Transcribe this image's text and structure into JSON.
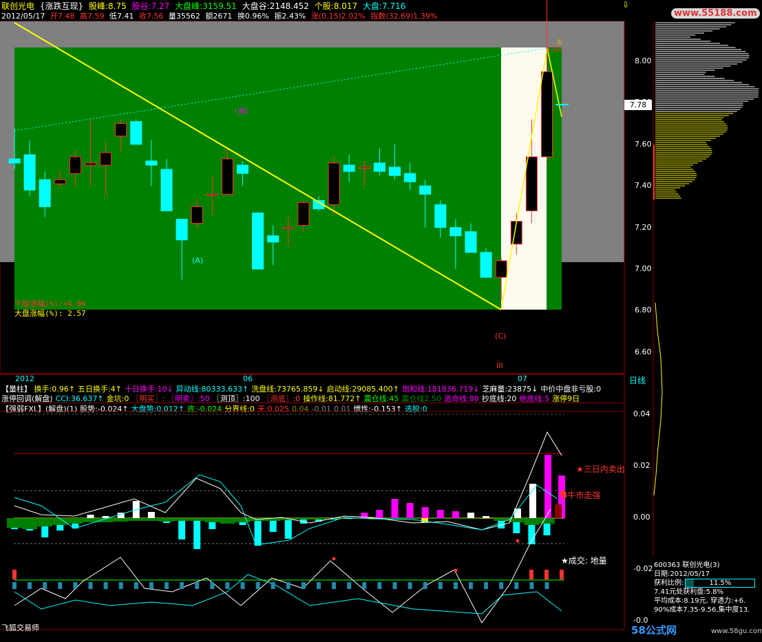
{
  "header": {
    "title": "联创光电",
    "indicator_name": "{涨跌互现}",
    "stock_peak": "股峰:8.75",
    "stock_valley": "股谷:7.27",
    "market_peak": "大盘峰:3159.51",
    "market_valley": "大盘谷:2148.452",
    "individual": "个股:8.017",
    "market": "大盘:7.716",
    "date": "2012/05/17",
    "open": "开7.48",
    "high": "高7.59",
    "low": "低7.41",
    "close": "收7.56",
    "volume": "量35562",
    "amount": "额2671",
    "turnover": "换0.96%",
    "amplitude": "振2.43%",
    "change": "涨(0.15)2.02%",
    "index_change": "指数(32.69)1.39%"
  },
  "main_chart": {
    "labels": {
      "A": "(A)",
      "B": "(B)",
      "C": "(C)",
      "roman3": "III",
      "circle1": "①",
      "peak_value": "8.50",
      "stock_change": "个股涨幅(%):+4.96",
      "market_change": "大盘涨幅(%): 2.57"
    },
    "price_axis": [
      "8.00",
      "7.80",
      "7.60",
      "7.40",
      "7.20",
      "7.00",
      "6.80",
      "6.60"
    ],
    "current_price_tag": "7.78",
    "time_axis": [
      "2012",
      "06",
      "07"
    ],
    "period": "日线"
  },
  "chart_data": {
    "type": "candlestick",
    "candles": [
      {
        "o": 7.53,
        "h": 7.68,
        "l": 7.48,
        "c": 7.51
      },
      {
        "o": 7.55,
        "h": 7.62,
        "l": 7.35,
        "c": 7.38
      },
      {
        "o": 7.43,
        "h": 7.47,
        "l": 7.25,
        "c": 7.3
      },
      {
        "o": 7.41,
        "h": 7.47,
        "l": 7.39,
        "c": 7.43
      },
      {
        "o": 7.46,
        "h": 7.57,
        "l": 7.4,
        "c": 7.54
      },
      {
        "o": 7.5,
        "h": 7.72,
        "l": 7.4,
        "c": 7.51
      },
      {
        "o": 7.5,
        "h": 7.61,
        "l": 7.35,
        "c": 7.56
      },
      {
        "o": 7.64,
        "h": 7.72,
        "l": 7.56,
        "c": 7.7
      },
      {
        "o": 7.71,
        "h": 7.72,
        "l": 7.6,
        "c": 7.6
      },
      {
        "o": 7.52,
        "h": 7.62,
        "l": 7.4,
        "c": 7.5
      },
      {
        "o": 7.48,
        "h": 7.53,
        "l": 7.28,
        "c": 7.28
      },
      {
        "o": 7.24,
        "h": 7.24,
        "l": 6.95,
        "c": 7.14
      },
      {
        "o": 7.22,
        "h": 7.34,
        "l": 7.2,
        "c": 7.3
      },
      {
        "o": 7.36,
        "h": 7.45,
        "l": 7.26,
        "c": 7.36
      },
      {
        "o": 7.36,
        "h": 7.58,
        "l": 7.35,
        "c": 7.53
      },
      {
        "o": 7.5,
        "h": 7.52,
        "l": 7.4,
        "c": 7.46
      },
      {
        "o": 7.27,
        "h": 7.27,
        "l": 7.0,
        "c": 7.0
      },
      {
        "o": 7.16,
        "h": 7.21,
        "l": 7.02,
        "c": 7.13
      },
      {
        "o": 7.2,
        "h": 7.25,
        "l": 7.11,
        "c": 7.2
      },
      {
        "o": 7.21,
        "h": 7.33,
        "l": 7.18,
        "c": 7.32
      },
      {
        "o": 7.33,
        "h": 7.35,
        "l": 7.28,
        "c": 7.29
      },
      {
        "o": 7.31,
        "h": 7.54,
        "l": 7.26,
        "c": 7.51
      },
      {
        "o": 7.5,
        "h": 7.55,
        "l": 7.42,
        "c": 7.47
      },
      {
        "o": 7.49,
        "h": 7.52,
        "l": 7.4,
        "c": 7.49
      },
      {
        "o": 7.51,
        "h": 7.58,
        "l": 7.45,
        "c": 7.47
      },
      {
        "o": 7.49,
        "h": 7.6,
        "l": 7.43,
        "c": 7.45
      },
      {
        "o": 7.46,
        "h": 7.51,
        "l": 7.38,
        "c": 7.42
      },
      {
        "o": 7.4,
        "h": 7.43,
        "l": 7.2,
        "c": 7.36
      },
      {
        "o": 7.31,
        "h": 7.33,
        "l": 7.15,
        "c": 7.2
      },
      {
        "o": 7.2,
        "h": 7.24,
        "l": 7.0,
        "c": 7.16
      },
      {
        "o": 7.18,
        "h": 7.22,
        "l": 7.08,
        "c": 7.08
      },
      {
        "o": 7.08,
        "h": 7.1,
        "l": 6.96,
        "c": 6.96
      },
      {
        "o": 6.96,
        "h": 7.05,
        "l": 6.85,
        "c": 7.04
      },
      {
        "o": 7.12,
        "h": 7.27,
        "l": 7.07,
        "c": 7.23
      },
      {
        "o": 7.28,
        "h": 7.72,
        "l": 7.22,
        "c": 7.54
      },
      {
        "o": 7.54,
        "h": 8.47,
        "l": 7.52,
        "c": 7.95
      }
    ]
  },
  "info_row1": {
    "bracket": "【量柱】",
    "items": [
      {
        "text": "换手:0.96↑",
        "color": "#ffff00"
      },
      {
        "text": "五日换手:4↑",
        "color": "#ffff00"
      },
      {
        "text": "十日换手:10↓",
        "color": "#ff00ff"
      },
      {
        "text": "异动线:80333.633↑",
        "color": "#00ffff"
      },
      {
        "text": "洗盘线:73765.859↓",
        "color": "#ffff00"
      },
      {
        "text": "启动线:29085.400↑",
        "color": "#ffff00"
      },
      {
        "text": "饱和线:181836.719↓",
        "color": "#ff00ff"
      },
      {
        "text": "芝麻量:23875↓",
        "color": "#ffffff"
      },
      {
        "text": "中价中盘非亏股:0",
        "color": "#ffffff"
      }
    ]
  },
  "info_row2": {
    "items": [
      {
        "text": "涨停回调(解盘)",
        "color": "#ffffff"
      },
      {
        "text": "CCI:36.637↑",
        "color": "#00ffff"
      },
      {
        "text": "金坑:0",
        "color": "#ffff00"
      },
      {
        "text": "〖明买〗:",
        "color": "#ff3333"
      },
      {
        "text": "〖明卖〗:50",
        "color": "#ff00ff"
      },
      {
        "text": "〖测顶〗:100",
        "color": "#ffffff"
      },
      {
        "text": "〖测底〗:0",
        "color": "#ff3333"
      },
      {
        "text": "操作线:81.772↑",
        "color": "#ffff00"
      },
      {
        "text": "震仓线:45",
        "color": "#00ff00"
      },
      {
        "text": "震仓线2:50",
        "color": "#008800"
      },
      {
        "text": "逃命线:80",
        "color": "#ff00ff"
      },
      {
        "text": "抄底线:20",
        "color": "#ffffff"
      },
      {
        "text": "绝底线:5",
        "color": "#ff00ff"
      },
      {
        "text": "涨停9日",
        "color": "#ffff00"
      }
    ]
  },
  "info_row3": {
    "items": [
      {
        "text": "【强弱FXL】(解盘)(1)",
        "color": "#ffffff"
      },
      {
        "text": "股势:-0.024↑",
        "color": "#ffffff"
      },
      {
        "text": "大盘势:0.012↑",
        "color": "#00ffff"
      },
      {
        "text": "底:-0.024",
        "color": "#00ff00"
      },
      {
        "text": "分界线:0",
        "color": "#ffff00"
      },
      {
        "text": "天:0.025",
        "color": "#ff3333"
      },
      {
        "text": "0.04",
        "color": "#888800"
      },
      {
        "text": "-0.01",
        "color": "#888888"
      },
      {
        "text": "0.01",
        "color": "#888888"
      },
      {
        "text": "惯性:-0.153↑",
        "color": "#ffffff"
      },
      {
        "text": "选股:0",
        "color": "#00ffff"
      }
    ]
  },
  "indicator": {
    "axis": [
      "0.04",
      "0.02",
      "0.00",
      "-0.02",
      "-0.0"
    ],
    "sell_hint": "★三日内卖出",
    "bull_hint": "◆牛市走强",
    "deal_hint": "★成交: 地量",
    "footer": "飞狐交易师"
  },
  "chip_panel": {
    "code_line": "600363  联创光电(3)",
    "date_line": "日期:2012/05/17",
    "profit_label": "获利比例:",
    "profit_value": "11.5%",
    "profit_fill": 0.115,
    "line1": "7.41元处获利盘:5.8%",
    "line2": "平均成本:8.19元, 穿透力:+6.",
    "line3": "90%成本7.35-9.56,集中度13."
  },
  "watermark": {
    "top": "www.55188.com",
    "bottom_brand": "58公式网",
    "bottom_url": "www.58gu.com"
  },
  "colors": {
    "green_field": "#008000",
    "gray_field": "#808080",
    "up_red": "#ff3333",
    "down_cyan": "#00ffff",
    "axis_red": "#8b0000"
  }
}
